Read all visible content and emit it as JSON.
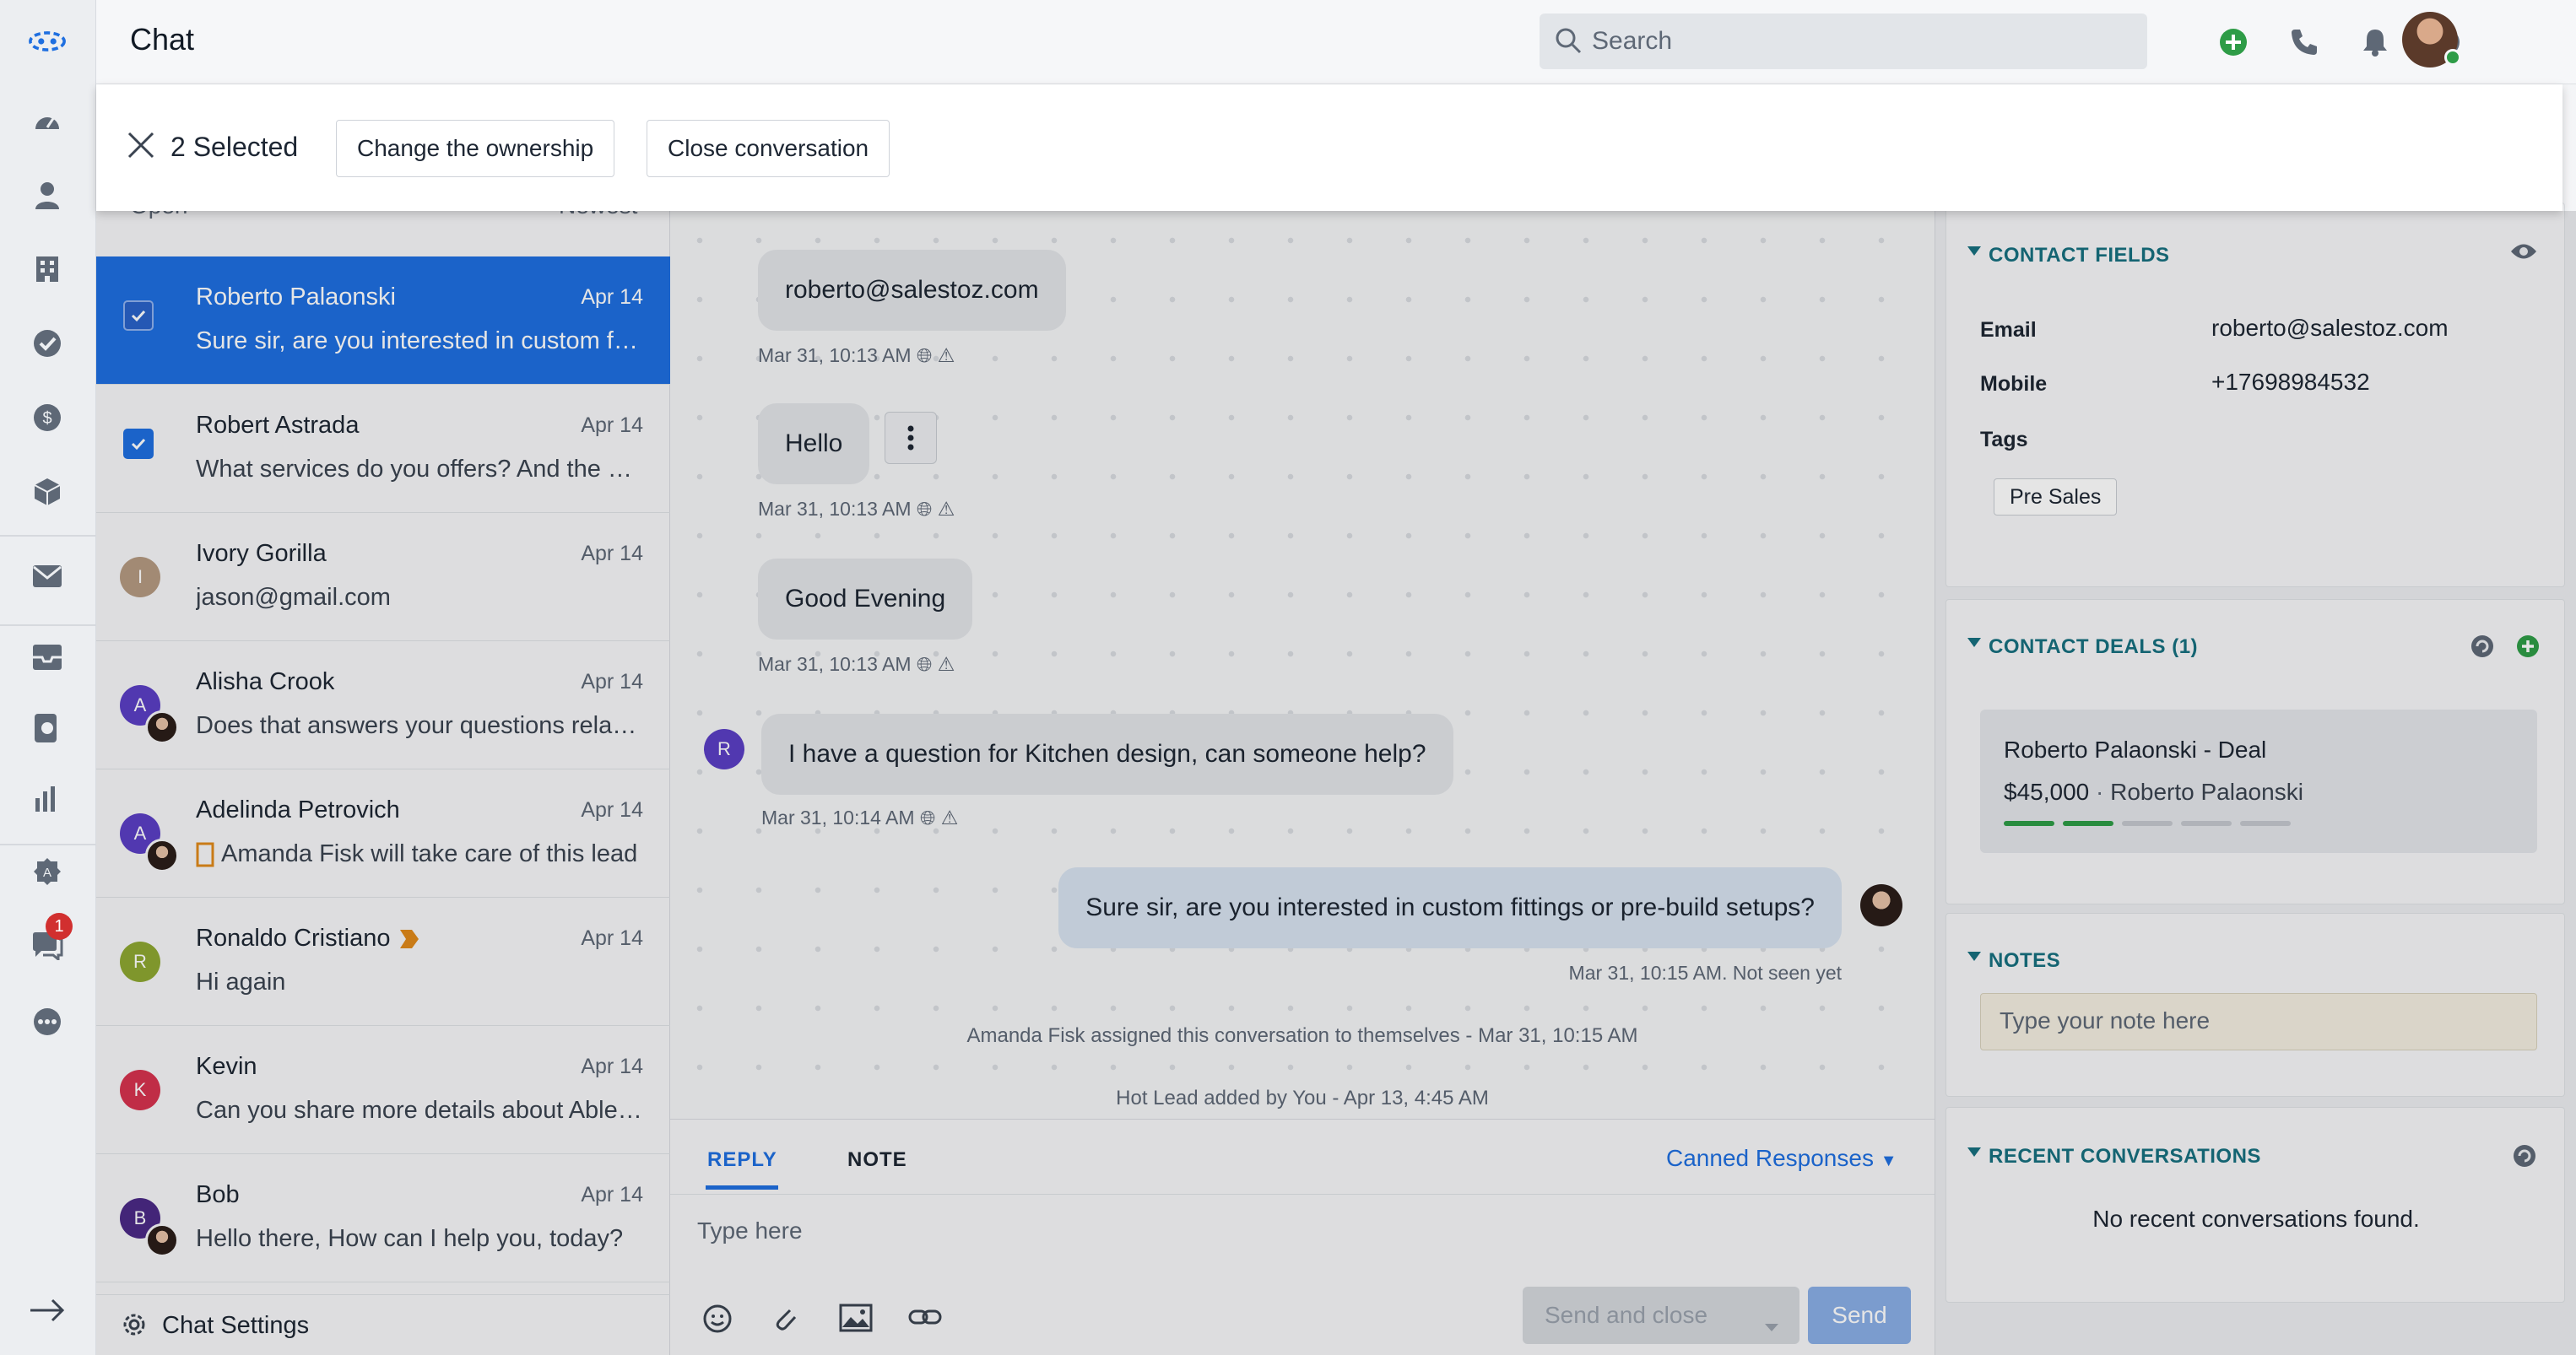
{
  "header": {
    "title": "Chat",
    "search_placeholder": "Search"
  },
  "selection": {
    "count_label": "2 Selected",
    "actions": [
      "Change the ownership",
      "Close conversation"
    ]
  },
  "rail": {
    "badge_count": "1"
  },
  "list": {
    "filter_left": "Open",
    "filter_right": "Newest",
    "items": [
      {
        "name": "Roberto Palaonski",
        "date": "Apr 14",
        "preview": "Sure sir, are you interested in custom fittings or pre-build setups?",
        "selected": true
      },
      {
        "name": "Robert Astrada",
        "date": "Apr 14",
        "preview": "What services do you offers? And the cost?",
        "selected": true
      },
      {
        "name": "Ivory Gorilla",
        "date": "Apr 14",
        "preview": "jason@gmail.com",
        "initial": "I",
        "color": "#b59a82"
      },
      {
        "name": "Alisha Crook",
        "date": "Apr 14",
        "preview": "Does that answers your questions related to the design?",
        "initial": "A",
        "color": "#5b3fc4"
      },
      {
        "name": "Adelinda Petrovich",
        "date": "Apr 14",
        "preview": "Amanda Fisk will take care of this lead",
        "initial": "A",
        "color": "#5b3fc4"
      },
      {
        "name": "Ronaldo Cristiano",
        "date": "Apr 14",
        "preview": "Hi again",
        "initial": "R",
        "color": "#8ea832"
      },
      {
        "name": "Kevin",
        "date": "Apr 14",
        "preview": "Can you share more details about Able Cabinets?",
        "initial": "K",
        "color": "#d6334e"
      },
      {
        "name": "Bob",
        "date": "Apr 14",
        "preview": "Hello there, How can I help you, today?",
        "initial": "B",
        "color": "#4b2a86"
      }
    ],
    "settings_label": "Chat Settings"
  },
  "chat": {
    "messages": [
      {
        "text": "roberto@salestoz.com",
        "meta": "Mar 31, 10:13 AM"
      },
      {
        "text": "Hello",
        "meta": "Mar 31, 10:13 AM"
      },
      {
        "text": "Good Evening",
        "meta": "Mar 31, 10:13 AM"
      },
      {
        "text": "I have a question for Kitchen design, can someone help?",
        "meta": "Mar 31, 10:14 AM",
        "initial": "R"
      },
      {
        "text": "Sure sir, are you interested in custom fittings or pre-build setups?",
        "meta": "Mar 31, 10:15 AM. Not seen yet"
      }
    ],
    "system": [
      "Amanda Fisk assigned this conversation to themselves - Mar 31, 10:15 AM",
      "Hot Lead added by You - Apr 13, 4:45 AM"
    ]
  },
  "composer": {
    "tab_reply": "REPLY",
    "tab_note": "NOTE",
    "canned": "Canned Responses",
    "placeholder": "Type here",
    "send_close": "Send and close",
    "send": "Send"
  },
  "contact_fields": {
    "title": "CONTACT FIELDS",
    "email_label": "Email",
    "email": "roberto@salestoz.com",
    "mobile_label": "Mobile",
    "mobile": "+17698984532",
    "tags_label": "Tags",
    "tag": "Pre Sales"
  },
  "contact_deals": {
    "title": "CONTACT DEALS (1)",
    "deal_name": "Roberto Palaonski - Deal",
    "amount": "$45,000",
    "owner": "Roberto Palaonski",
    "stages_done": 2,
    "stages_total": 5
  },
  "notes": {
    "title": "NOTES",
    "placeholder": "Type your note here"
  },
  "recent": {
    "title": "RECENT CONVERSATIONS",
    "empty": "No recent conversations found."
  },
  "colors": {
    "accent": "#1f6fe0",
    "teal": "#17707f",
    "green": "#2e9c47"
  }
}
